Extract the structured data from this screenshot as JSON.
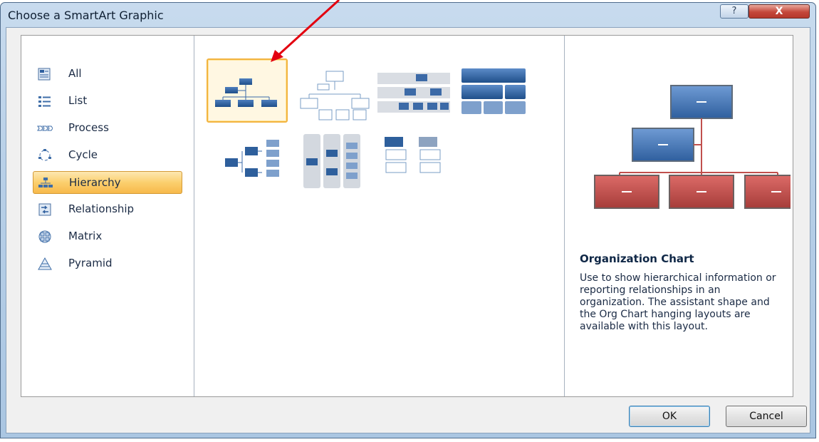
{
  "dialog": {
    "title": "Choose a SmartArt Graphic",
    "help_label": "?",
    "close_label": "X"
  },
  "categories": [
    {
      "label": "All",
      "icon": "all-icon"
    },
    {
      "label": "List",
      "icon": "list-icon"
    },
    {
      "label": "Process",
      "icon": "process-icon"
    },
    {
      "label": "Cycle",
      "icon": "cycle-icon"
    },
    {
      "label": "Hierarchy",
      "icon": "hierarchy-icon",
      "selected": true
    },
    {
      "label": "Relationship",
      "icon": "relationship-icon"
    },
    {
      "label": "Matrix",
      "icon": "matrix-icon"
    },
    {
      "label": "Pyramid",
      "icon": "pyramid-icon"
    }
  ],
  "layouts": [
    {
      "name": "organization-chart",
      "selected": true
    },
    {
      "name": "name-and-title-org-chart"
    },
    {
      "name": "labeled-hierarchy"
    },
    {
      "name": "table-hierarchy"
    },
    {
      "name": "horizontal-hierarchy"
    },
    {
      "name": "horizontal-labeled-hierarchy"
    },
    {
      "name": "hierarchy-list"
    }
  ],
  "preview": {
    "title": "Organization Chart",
    "description": "Use to show hierarchical information or reporting relationships in an organization. The assistant shape and the Org Chart hanging layouts are available with this layout."
  },
  "buttons": {
    "ok": "OK",
    "cancel": "Cancel"
  },
  "colors": {
    "accent_blue": "#4f7fbe",
    "preview_red": "#c0504d",
    "selection_orange": "#f7b94b",
    "annotation_arrow": "#e3000f"
  }
}
